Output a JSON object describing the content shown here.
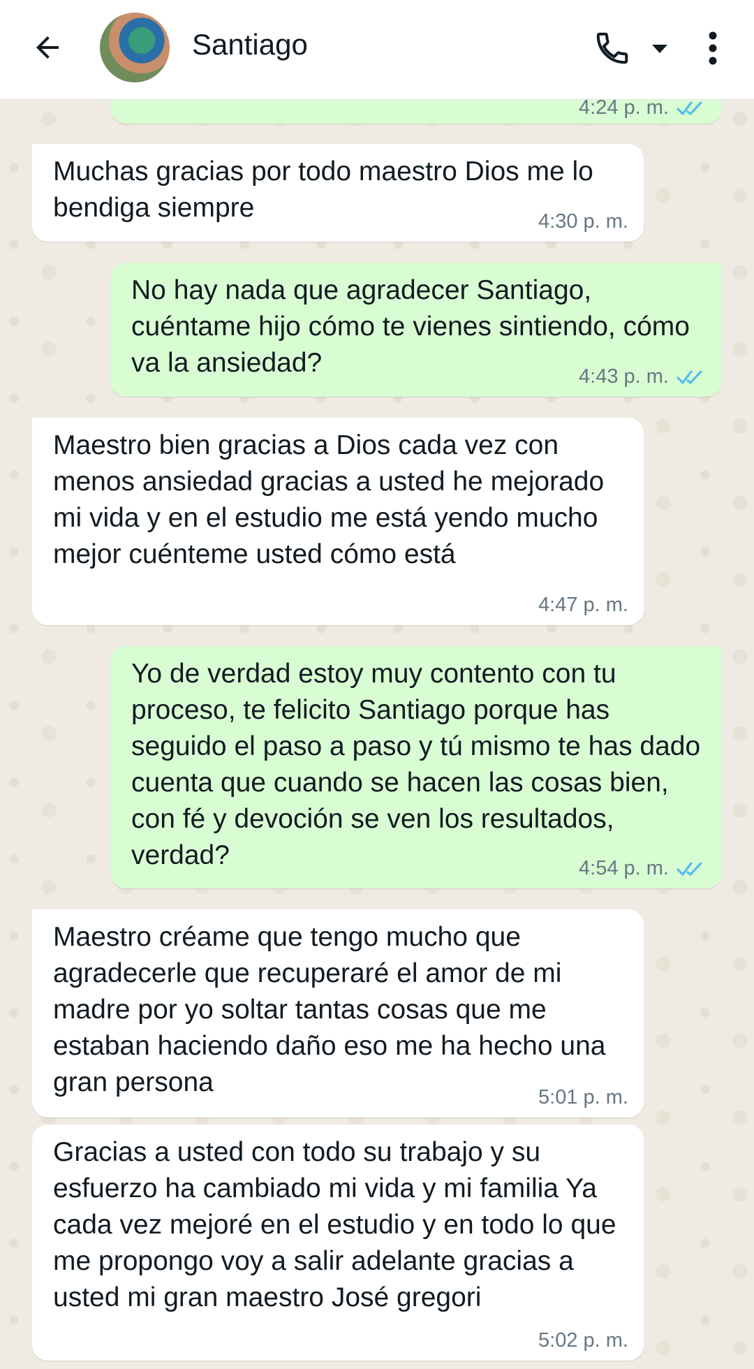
{
  "header": {
    "contact_name": "Santiago",
    "icons": {
      "back": "arrow-left-icon",
      "call": "phone-icon",
      "call_menu": "caret-down-icon",
      "more": "more-vertical-icon"
    }
  },
  "colors": {
    "incoming": "#ffffff",
    "outgoing": "#d9fdd3",
    "read_ticks": "#53bdeb",
    "time": "#667781"
  },
  "messages": [
    {
      "direction": "out",
      "text": "",
      "time": "4:24 p. m.",
      "status": "read"
    },
    {
      "direction": "in",
      "text": "Muchas gracias por todo maestro Dios me lo bendiga siempre",
      "time": "4:30 p. m."
    },
    {
      "direction": "out",
      "text": "No hay nada que agradecer Santiago, cuéntame hijo cómo te vienes sintiendo, cómo va la ansiedad?",
      "time": "4:43 p. m.",
      "status": "read"
    },
    {
      "direction": "in",
      "text": "Maestro bien gracias a Dios cada vez con menos ansiedad gracias a usted he mejorado mi vida y en el estudio me está yendo mucho mejor cuénteme usted cómo está",
      "time": "4:47 p. m."
    },
    {
      "direction": "out",
      "text": "Yo de verdad estoy muy contento con tu proceso, te felicito Santiago porque has seguido el paso a paso y tú mismo te has dado cuenta que cuando se hacen las cosas bien, con fé y devoción se ven los resultados, verdad?",
      "time": "4:54 p. m.",
      "status": "read"
    },
    {
      "direction": "in",
      "text": "Maestro créame que tengo mucho que agradecerle que recuperaré el amor de mi madre por yo soltar tantas cosas que me estaban haciendo daño eso me ha hecho una gran persona",
      "time": "5:01 p. m."
    },
    {
      "direction": "in",
      "text": "Gracias a usted con todo su trabajo y su esfuerzo ha cambiado mi vida y mi familia Ya cada vez mejoré en el estudio y en todo lo que me propongo voy a salir adelante gracias a usted mi gran maestro José gregori",
      "time": "5:02 p. m."
    }
  ]
}
